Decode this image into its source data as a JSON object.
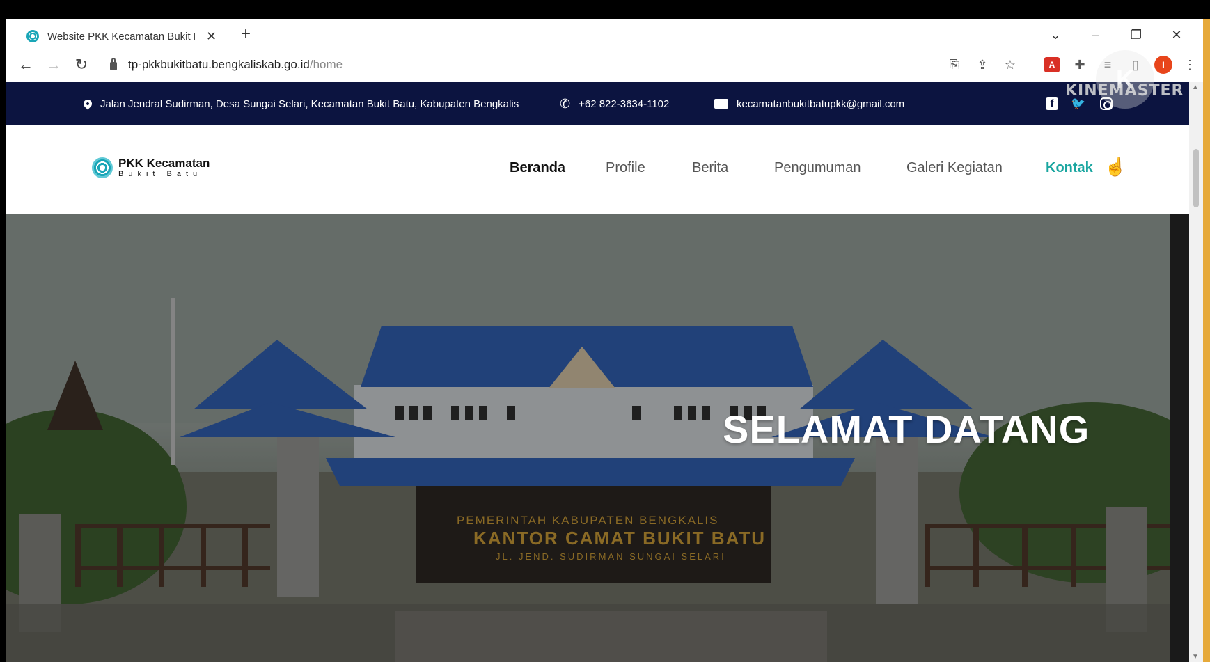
{
  "browser": {
    "tab_title": "Website PKK Kecamatan Bukit B",
    "url_host": "tp-pkkbukitbatu.bengkaliskab.go.id",
    "url_path": "/home",
    "profile_initial": "I"
  },
  "watermark": {
    "text": "KINEMASTER",
    "badge": "K"
  },
  "topbar": {
    "address": "Jalan Jendral Sudirman, Desa Sungai Selari, Kecamatan Bukit Batu, Kabupaten Bengkalis",
    "phone": "+62 822-3634-1102",
    "email": "kecamatanbukitbatupkk@gmail.com"
  },
  "logo": {
    "line1": "PKK Kecamatan",
    "line2": "Bukit Batu"
  },
  "nav": {
    "items": [
      {
        "label": "Beranda"
      },
      {
        "label": "Profile"
      },
      {
        "label": "Berita"
      },
      {
        "label": "Pengumuman"
      },
      {
        "label": "Galeri Kegiatan"
      },
      {
        "label": "Kontak"
      }
    ]
  },
  "hero": {
    "title": "SELAMAT DATANG",
    "sign_line1": "PEMERINTAH KABUPATEN BENGKALIS",
    "sign_line2": "KANTOR CAMAT BUKIT BATU",
    "sign_line3": "JL. JEND. SUDIRMAN SUNGAI SELARI"
  }
}
